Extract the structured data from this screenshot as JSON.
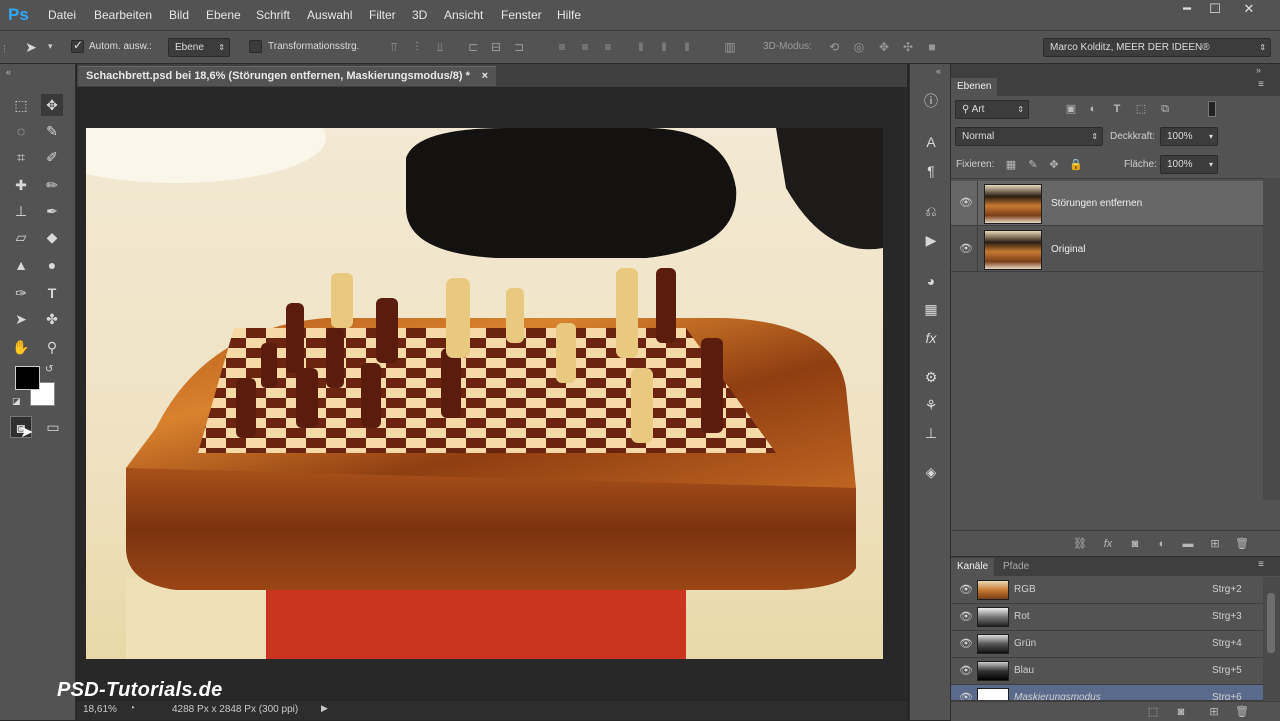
{
  "app": {
    "logo": "Ps"
  },
  "menu": [
    "Datei",
    "Bearbeiten",
    "Bild",
    "Ebene",
    "Schrift",
    "Auswahl",
    "Filter",
    "3D",
    "Ansicht",
    "Fenster",
    "Hilfe"
  ],
  "window_controls": {
    "minimize": "━",
    "maximize": "☐",
    "close": "✕"
  },
  "options": {
    "auto_select_label": "Autom. ausw.:",
    "auto_select_value": "Ebene",
    "transform_label": "Transformationsstrg.",
    "mode3d_label": "3D-Modus:",
    "workspace_value": "Marco Kolditz, MEER DER IDEEN®"
  },
  "document": {
    "tab_title": "Schachbrett.psd bei 18,6% (Störungen entfernen, Maskierungsmodus/8) *",
    "close": "×"
  },
  "status": {
    "zoom": "18,61%",
    "dimensions": "4288 Px x 2848 Px (300 ppi)"
  },
  "watermark": "PSD-Tutorials.de",
  "layers_panel": {
    "tab": "Ebenen",
    "filter_label": "Art",
    "blend_mode": "Normal",
    "opacity_label": "Deckkraft:",
    "opacity_value": "100%",
    "lock_label": "Fixieren:",
    "fill_label": "Fläche:",
    "fill_value": "100%",
    "layers": [
      {
        "name": "Störungen entfernen",
        "selected": true
      },
      {
        "name": "Original",
        "selected": false
      }
    ]
  },
  "channels_panel": {
    "tabs": [
      "Kanäle",
      "Pfade"
    ],
    "channels": [
      {
        "name": "RGB",
        "shortcut": "Strg+2"
      },
      {
        "name": "Rot",
        "shortcut": "Strg+3"
      },
      {
        "name": "Grün",
        "shortcut": "Strg+4"
      },
      {
        "name": "Blau",
        "shortcut": "Strg+5"
      },
      {
        "name": "Maskierungsmodus",
        "shortcut": "Strg+6"
      }
    ]
  },
  "colors": {
    "accent": "#31a8ff",
    "panel": "#535353",
    "dark": "#262626",
    "selected_layer": "#676767",
    "mask_row": "#5a6a8a"
  }
}
